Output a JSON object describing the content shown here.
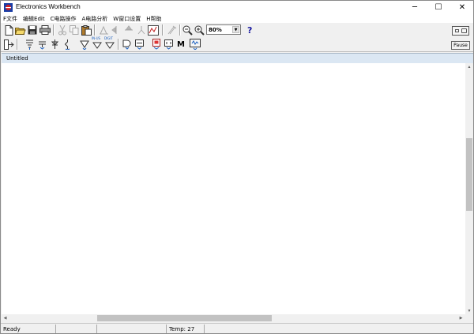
{
  "window": {
    "title": "Electronics Workbench",
    "minimize_glyph": "─",
    "maximize_glyph": "☐",
    "close_glyph": "✕"
  },
  "menu": [
    {
      "label": "F文件"
    },
    {
      "label": "编辑Edit"
    },
    {
      "label": "C电路操作"
    },
    {
      "label": "A电路分析"
    },
    {
      "label": "W窗口设置"
    },
    {
      "label": "H帮助"
    }
  ],
  "toolbar": {
    "zoom_value": "80%",
    "help_label": "?",
    "pause_label": "Pause",
    "icons": [
      "new-file-icon",
      "open-folder-icon",
      "save-icon",
      "print-icon",
      "cut-icon",
      "copy-icon",
      "paste-icon",
      "rotate-icon",
      "flip-horizontal-icon",
      "flip-vertical-icon",
      "subcircuit-icon",
      "graph-icon",
      "component-properties-icon",
      "zoom-out-icon",
      "zoom-in-icon",
      "help-icon"
    ]
  },
  "parts_bin": {
    "small_labels": [
      "IN-US",
      "HUEO",
      "DIGIT"
    ],
    "misc_label": "M"
  },
  "document": {
    "title": "Untitled"
  },
  "status": {
    "ready": "Ready",
    "temp": "Temp:  27"
  },
  "colors": {
    "title_bar": "#ffffff",
    "doc_tab": "#dbe7f3",
    "canvas": "#ffffff",
    "help_blue": "#1a1aa0"
  }
}
